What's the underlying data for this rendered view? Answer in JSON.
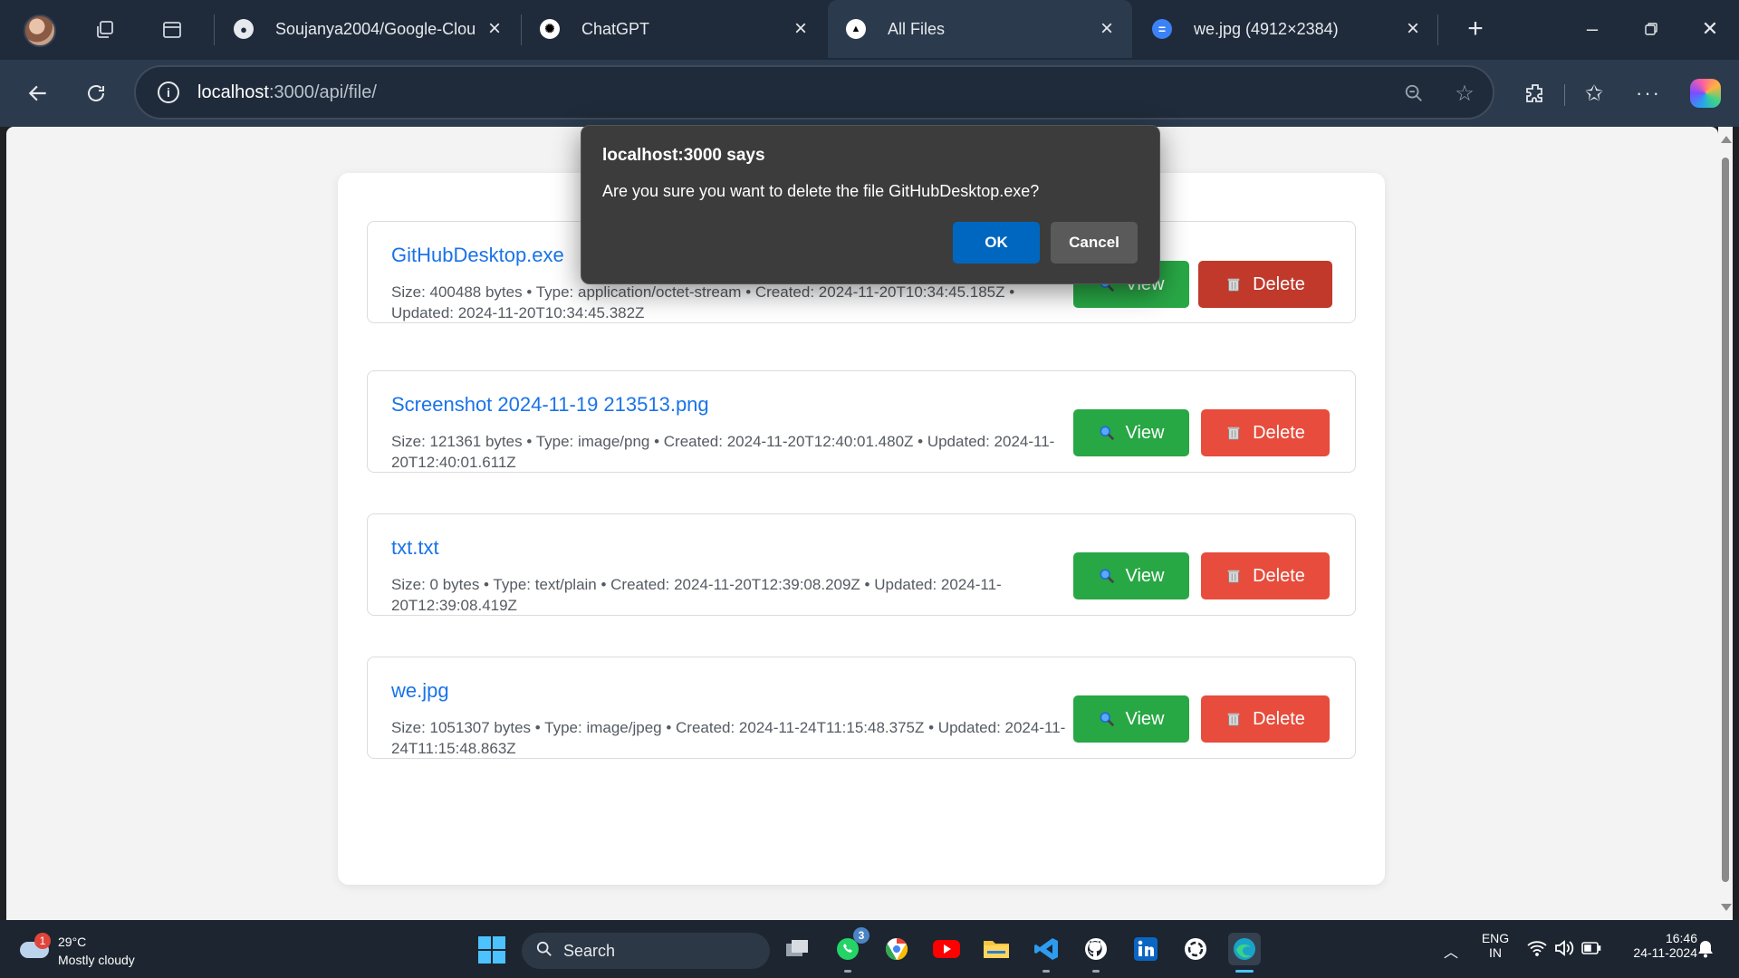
{
  "browser": {
    "tabs": [
      {
        "title": "Soujanya2004/Google-Clou",
        "icon": "github-icon"
      },
      {
        "title": "ChatGPT",
        "icon": "openai-icon"
      },
      {
        "title": "All Files",
        "icon": "vercel-triangle-icon",
        "active": true
      },
      {
        "title": "we.jpg (4912×2384)",
        "icon": "image-icon"
      }
    ],
    "url_host": "localhost",
    "url_rest": ":3000/api/file/"
  },
  "files": [
    {
      "name": "GitHubDesktop.exe",
      "meta": "Size: 400488 bytes • Type: application/octet-stream • Created: 2024-11-20T10:34:45.185Z • Updated: 2024-11-20T10:34:45.382Z"
    },
    {
      "name": "Screenshot 2024-11-19 213513.png",
      "meta": "Size: 121361 bytes • Type: image/png • Created: 2024-11-20T12:40:01.480Z • Updated: 2024-11-20T12:40:01.611Z"
    },
    {
      "name": "txt.txt",
      "meta": "Size: 0 bytes • Type: text/plain • Created: 2024-11-20T12:39:08.209Z • Updated: 2024-11-20T12:39:08.419Z"
    },
    {
      "name": "we.jpg",
      "meta": "Size: 1051307 bytes • Type: image/jpeg • Created: 2024-11-24T11:15:48.375Z • Updated: 2024-11-24T11:15:48.863Z"
    }
  ],
  "buttons": {
    "view_label": "View",
    "delete_label": "Delete"
  },
  "dialog": {
    "title": "localhost:3000 says",
    "message": "Are you sure you want to delete the file GitHubDesktop.exe?",
    "ok_label": "OK",
    "cancel_label": "Cancel"
  },
  "taskbar": {
    "weather_badge": "1",
    "temperature": "29°C",
    "condition": "Mostly cloudy",
    "search_label": "Search",
    "whatsapp_badge": "3",
    "language": "ENG",
    "region": "IN",
    "time": "16:46",
    "date": "24-11-2024"
  },
  "colors": {
    "view": "#28a745",
    "delete": "#e74c3c",
    "link": "#1a73e8",
    "dialog_ok": "#0067c0"
  }
}
